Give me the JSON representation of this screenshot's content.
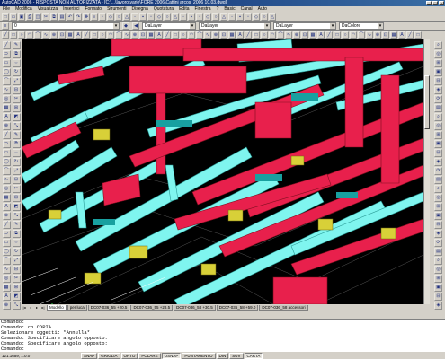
{
  "window": {
    "title": "AutoCAD 2006 - RISPOSTA NON AUTORIZZATA - [C:\\...\\lavoro\\varie\\FORE 2006\\Cattini arcos_2006 10.03.dwg]",
    "controls": [
      "_",
      "□",
      "×"
    ]
  },
  "menu": [
    "File",
    "Modifica",
    "Visualizza",
    "Inserisci",
    "Formato",
    "Strumenti",
    "Disegna",
    "Quotatura",
    "Edita",
    "Finestra",
    "?",
    "Basic",
    "Canal",
    "Auto"
  ],
  "toolbar1": {
    "icons": [
      "new-icon",
      "open-icon",
      "save-icon",
      "print-icon",
      "preview-icon",
      "cut-icon",
      "copy-icon",
      "paste-icon",
      "undo-icon",
      "redo-icon",
      "pan-icon",
      "zoom-icon"
    ]
  },
  "toolbar2": {
    "layer_value": "0",
    "color_value": "DaLayer",
    "linetype_value": "DaLayer",
    "lineweight_value": "DaLayer",
    "plotstyle_value": "DaColore"
  },
  "tabs": {
    "nav": [
      "|◂",
      "◂",
      "▸",
      "▸|"
    ],
    "items": [
      "Modello",
      "per luca",
      "DC07-036_55 +20.5",
      "DC07-036_55 +28.5",
      "DC07-036_58 +30.5",
      "DC07-036_58 +59.0",
      "DC07-036_58 accessori"
    ],
    "active": 0
  },
  "command": {
    "lines": [
      "Comando:",
      "Comando: cp COPIA",
      "Selezionare oggetti: *Annulla*",
      "Comando: Specificare angolo opposto:",
      "Comando: Specificare angolo opposto:",
      "Comando:"
    ]
  },
  "status": {
    "coords": "121.1659, 1.0.0",
    "buttons": [
      "SNAP",
      "GRIGLIA",
      "ORTO",
      "POLARE",
      "OSNAP",
      "PUNTAMENTO",
      "DIN",
      "SUV",
      "CARTA"
    ],
    "on": [
      "OSNAP",
      "CARTA"
    ]
  },
  "colors": {
    "duct_red": "#e8204c",
    "duct_cyan": "#7ff5ef",
    "duct_yellow": "#d8d038",
    "background": "#000000"
  }
}
